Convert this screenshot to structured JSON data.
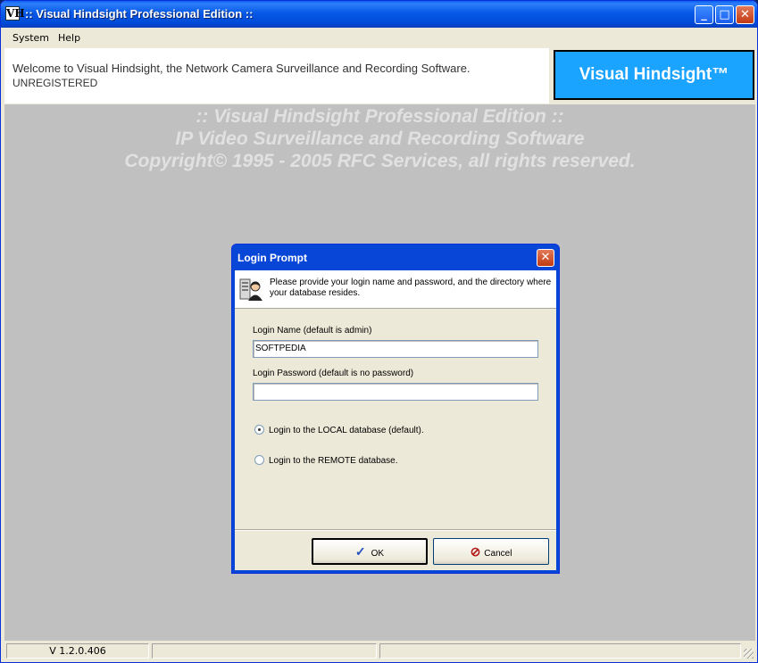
{
  "window": {
    "title": ":: Visual Hindsight Professional Edition ::",
    "icon_label": "VH",
    "controls": {
      "minimize": "_",
      "maximize": "□",
      "close": "✕"
    }
  },
  "menu": {
    "items": [
      "System",
      "Help"
    ]
  },
  "header": {
    "welcome": "Welcome to Visual Hindsight, the Network Camera Surveillance and Recording Software.",
    "status": "UNREGISTERED",
    "brand": "Visual Hindsight™"
  },
  "banner": {
    "line1": ":: Visual Hindsight Professional Edition ::",
    "line2": "IP Video Surveillance and Recording Software",
    "line3": "Copyright© 1995 - 2005 RFC Services, all rights reserved."
  },
  "dialog": {
    "title": "Login Prompt",
    "close": "✕",
    "message": "Please provide your login name and password, and the directory where your database resides.",
    "login_name_label": "Login Name (default is admin)",
    "login_name_value": "SOFTPEDIA",
    "password_label": "Login Password (default is no password)",
    "password_value": "",
    "radio_local": "Login to the LOCAL database (default).",
    "radio_remote": "Login to the REMOTE database.",
    "ok_label": "OK",
    "cancel_label": "Cancel"
  },
  "statusbar": {
    "version": "V 1.2.0.406"
  },
  "colors": {
    "brand_bg": "#1aa3ff",
    "client_bg": "#c0c0c0",
    "titlebar": "#0759e8"
  }
}
